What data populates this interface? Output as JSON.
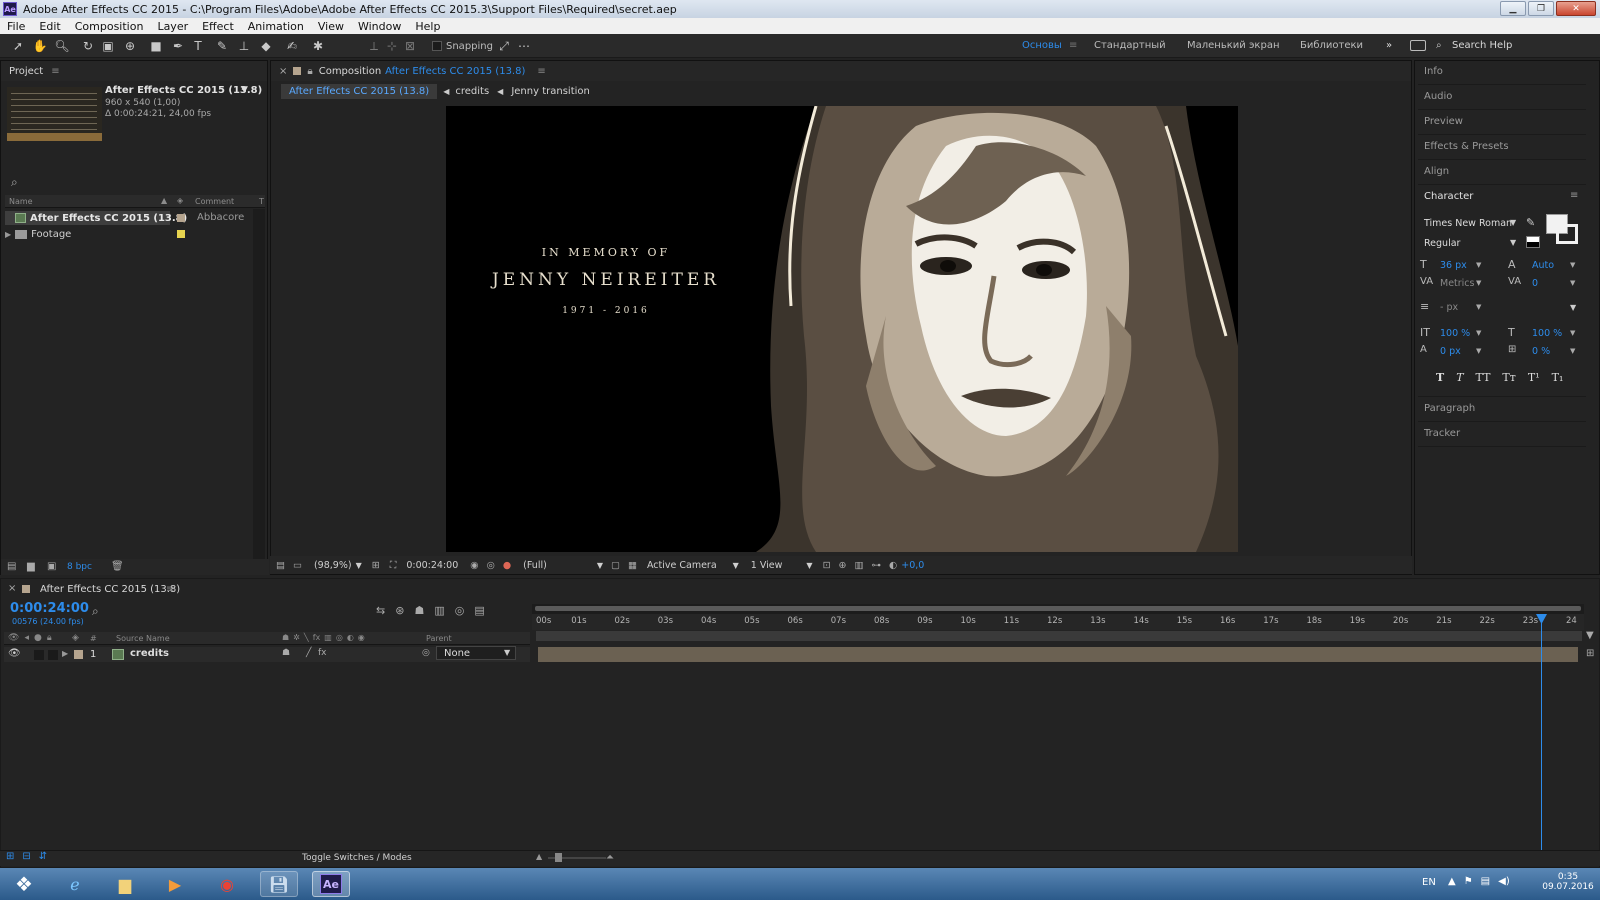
{
  "window": {
    "title": "Adobe After Effects CC 2015 - C:\\Program Files\\Adobe\\Adobe After Effects CC 2015.3\\Support Files\\Required\\secret.aep"
  },
  "menu": [
    "File",
    "Edit",
    "Composition",
    "Layer",
    "Effect",
    "Animation",
    "View",
    "Window",
    "Help"
  ],
  "toolbar": {
    "snapping_label": "Snapping",
    "workspaces": [
      "Основы",
      "Стандартный",
      "Маленький экран",
      "Библиотеки"
    ],
    "search_help": "Search Help"
  },
  "project": {
    "panel_title": "Project",
    "comp_name": "After Effects CC 2015 (13.8)",
    "comp_size": "960 x 540 (1,00)",
    "comp_duration": "Δ 0:00:24:21, 24,00 fps",
    "col_name": "Name",
    "col_comment": "Comment",
    "col_type": "T",
    "items": [
      {
        "name": "After Effects CC 2015 (13.8)",
        "comment": "Abbacore"
      },
      {
        "name": "Footage",
        "comment": ""
      }
    ],
    "bpc": "8 bpc"
  },
  "composition": {
    "panel_label": "Composition",
    "panel_comp": "After Effects CC 2015 (13.8)",
    "breadcrumbs": [
      "After Effects CC 2015 (13.8)",
      "credits",
      "Jenny transition"
    ],
    "text_line1": "IN MEMORY OF",
    "text_line2": "JENNY NEIREITER",
    "text_line3": "1971 - 2016",
    "zoom": "(98,9%)",
    "timecode": "0:00:24:00",
    "resolution": "(Full)",
    "camera": "Active Camera",
    "views": "1 View",
    "exposure": "+0,0"
  },
  "right_panel": {
    "items_top": [
      "Info",
      "Audio",
      "Preview",
      "Effects & Presets",
      "Align"
    ],
    "character_title": "Character",
    "font": "Times New Roman",
    "style": "Regular",
    "font_size": "36 px",
    "leading": "Auto",
    "kerning": "Metrics",
    "tracking": "0",
    "stroke": "- px",
    "vscale": "100 %",
    "hscale": "100 %",
    "baseline": "0 px",
    "tsume": "0 %",
    "type_styles": [
      "T",
      "T",
      "TT",
      "Tт",
      "T¹",
      "T₁"
    ],
    "items_bottom": [
      "Paragraph",
      "Tracker"
    ]
  },
  "timeline": {
    "tab_title": "After Effects CC 2015 (13.8)",
    "timecode": "0:00:24:00",
    "frames": "00576 (24.00 fps)",
    "col_source": "Source Name",
    "col_parent": "Parent",
    "col_hash": "#",
    "layer_index": "1",
    "layer_name": "credits",
    "parent_value": "None",
    "ruler": [
      "00s",
      "01s",
      "02s",
      "03s",
      "04s",
      "05s",
      "06s",
      "07s",
      "08s",
      "09s",
      "10s",
      "11s",
      "12s",
      "13s",
      "14s",
      "15s",
      "16s",
      "17s",
      "18s",
      "19s",
      "20s",
      "21s",
      "22s",
      "23s",
      "24"
    ],
    "toggle_label": "Toggle Switches / Modes"
  },
  "taskbar": {
    "lang": "EN",
    "time": "0:35",
    "date": "09.07.2016"
  }
}
